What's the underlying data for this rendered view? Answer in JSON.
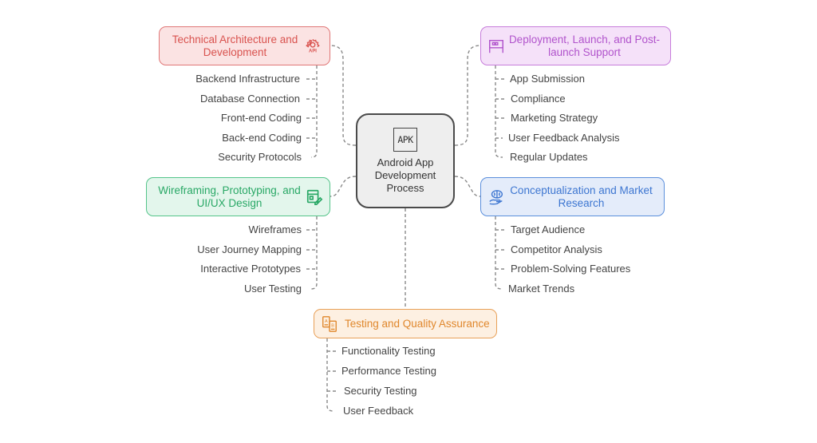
{
  "center": {
    "icon": "apk-icon",
    "icon_text": "APK",
    "title": "Android App Development Process"
  },
  "branches": {
    "tech": {
      "title": "Technical Architecture and Development",
      "icon": "gear-api-icon",
      "color": "#d9534f",
      "items": [
        "Backend Infrastructure",
        "Database Connection",
        "Front-end Coding",
        "Back-end Coding",
        "Security Protocols"
      ]
    },
    "deploy": {
      "title": "Deployment, Launch, and Post-launch Support",
      "icon": "billboard-icon",
      "color": "#b154cc",
      "items": [
        "App Submission",
        "Compliance",
        "Marketing Strategy",
        "User Feedback Analysis",
        "Regular Updates"
      ]
    },
    "wire": {
      "title": "Wireframing, Prototyping, and UI/UX Design",
      "icon": "design-edit-icon",
      "color": "#29a866",
      "items": [
        "Wireframes",
        "User Journey Mapping",
        "Interactive Prototypes",
        "User Testing"
      ]
    },
    "concept": {
      "title": "Conceptualization and Market Research",
      "icon": "brain-hand-icon",
      "color": "#3d76d1",
      "items": [
        "Target Audience",
        "Competitor Analysis",
        "Problem-Solving Features",
        "Market Trends"
      ]
    },
    "test": {
      "title": "Testing and Quality Assurance",
      "icon": "ab-test-icon",
      "color": "#e0872c",
      "items": [
        "Functionality Testing",
        "Performance Testing",
        "Security Testing",
        "User Feedback"
      ]
    }
  }
}
